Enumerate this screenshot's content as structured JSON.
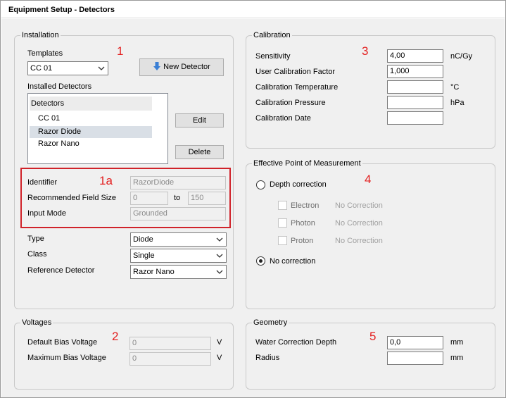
{
  "window": {
    "title": "Equipment Setup - Detectors"
  },
  "annotations": {
    "installation": "1",
    "sensor_info": "1a",
    "voltages": "2",
    "calibration": "3",
    "epom": "4",
    "geometry": "5"
  },
  "installation": {
    "title": "Installation",
    "templates_label": "Templates",
    "template_value": "CC 01",
    "new_detector_label": "New Detector",
    "installed_label": "Installed Detectors",
    "list_header": "Detectors",
    "detectors": [
      "CC 01",
      "Razor Diode",
      "Razor Nano"
    ],
    "selected_detector": "Razor Diode",
    "edit_label": "Edit",
    "delete_label": "Delete",
    "identifier_label": "Identifier",
    "identifier_value": "RazorDiode",
    "field_size_label": "Recommended Field Size",
    "field_size_from": "0",
    "field_size_to_label": "to",
    "field_size_to": "150",
    "input_mode_label": "Input Mode",
    "input_mode_value": "Grounded",
    "type_label": "Type",
    "type_value": "Diode",
    "class_label": "Class",
    "class_value": "Single",
    "ref_label": "Reference Detector",
    "ref_value": "Razor Nano"
  },
  "voltages": {
    "title": "Voltages",
    "default_label": "Default Bias Voltage",
    "default_value": "0",
    "max_label": "Maximum Bias Voltage",
    "max_value": "0",
    "unit": "V"
  },
  "calibration": {
    "title": "Calibration",
    "sensitivity_label": "Sensitivity",
    "sensitivity_value": "4,00",
    "sensitivity_unit": "nC/Gy",
    "factor_label": "User Calibration Factor",
    "factor_value": "1,000",
    "temp_label": "Calibration Temperature",
    "temp_value": "",
    "temp_unit": "°C",
    "pressure_label": "Calibration Pressure",
    "pressure_value": "",
    "pressure_unit": "hPa",
    "date_label": "Calibration Date",
    "date_value": ""
  },
  "epom": {
    "title": "Effective Point of Measurement",
    "depth_label": "Depth correction",
    "electron_label": "Electron",
    "photon_label": "Photon",
    "proton_label": "Proton",
    "no_corr_value": "No Correction",
    "no_correction_label": "No correction",
    "selected": "No correction"
  },
  "geometry": {
    "title": "Geometry",
    "water_label": "Water Correction Depth",
    "water_value": "0,0",
    "radius_label": "Radius",
    "radius_value": "",
    "unit": "mm"
  }
}
